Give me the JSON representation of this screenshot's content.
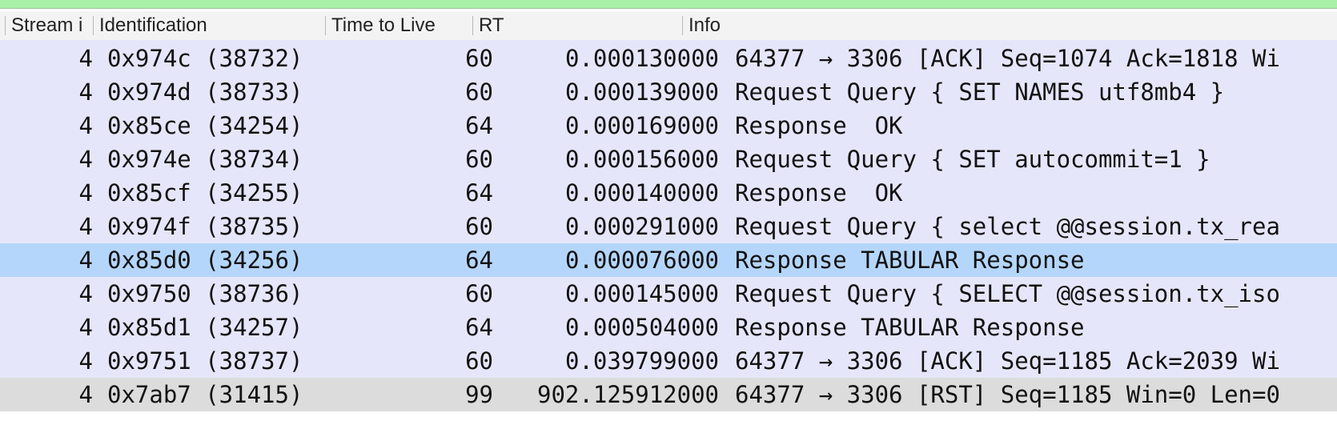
{
  "columns": [
    {
      "key": "stream",
      "label": "Stream i"
    },
    {
      "key": "ident",
      "label": "Identification"
    },
    {
      "key": "ttl",
      "label": "Time to Live"
    },
    {
      "key": "rt",
      "label": "RT"
    },
    {
      "key": "info",
      "label": "Info"
    }
  ],
  "rows": [
    {
      "stream": "4",
      "ident": "0x974c (38732)",
      "ttl": "60",
      "rt": "0.000130000",
      "info": "64377 → 3306 [ACK] Seq=1074 Ack=1818 Wi"
    },
    {
      "stream": "4",
      "ident": "0x974d (38733)",
      "ttl": "60",
      "rt": "0.000139000",
      "info": "Request Query { SET NAMES utf8mb4 }"
    },
    {
      "stream": "4",
      "ident": "0x85ce (34254)",
      "ttl": "64",
      "rt": "0.000169000",
      "info": "Response  OK"
    },
    {
      "stream": "4",
      "ident": "0x974e (38734)",
      "ttl": "60",
      "rt": "0.000156000",
      "info": "Request Query { SET autocommit=1 }"
    },
    {
      "stream": "4",
      "ident": "0x85cf (34255)",
      "ttl": "64",
      "rt": "0.000140000",
      "info": "Response  OK"
    },
    {
      "stream": "4",
      "ident": "0x974f (38735)",
      "ttl": "60",
      "rt": "0.000291000",
      "info": "Request Query { select @@session.tx_rea"
    },
    {
      "stream": "4",
      "ident": "0x85d0 (34256)",
      "ttl": "64",
      "rt": "0.000076000",
      "info": "Response TABULAR Response"
    },
    {
      "stream": "4",
      "ident": "0x9750 (38736)",
      "ttl": "60",
      "rt": "0.000145000",
      "info": "Request Query { SELECT @@session.tx_iso"
    },
    {
      "stream": "4",
      "ident": "0x85d1 (34257)",
      "ttl": "64",
      "rt": "0.000504000",
      "info": "Response TABULAR Response"
    },
    {
      "stream": "4",
      "ident": "0x9751 (38737)",
      "ttl": "60",
      "rt": "0.039799000",
      "info": "64377 → 3306 [ACK] Seq=1185 Ack=2039 Wi"
    },
    {
      "stream": "4",
      "ident": "0x7ab7 (31415)",
      "ttl": "99",
      "rt": "902.125912000",
      "info": "64377 → 3306 [RST] Seq=1185 Win=0 Len=0"
    }
  ],
  "selected_row_index": 6,
  "colors": {
    "row_bg": "#e6e6fa",
    "selected_bg": "#b5d6fb",
    "last_row_bg": "#dcdcdc",
    "top_strip": "#a8f0a8"
  }
}
